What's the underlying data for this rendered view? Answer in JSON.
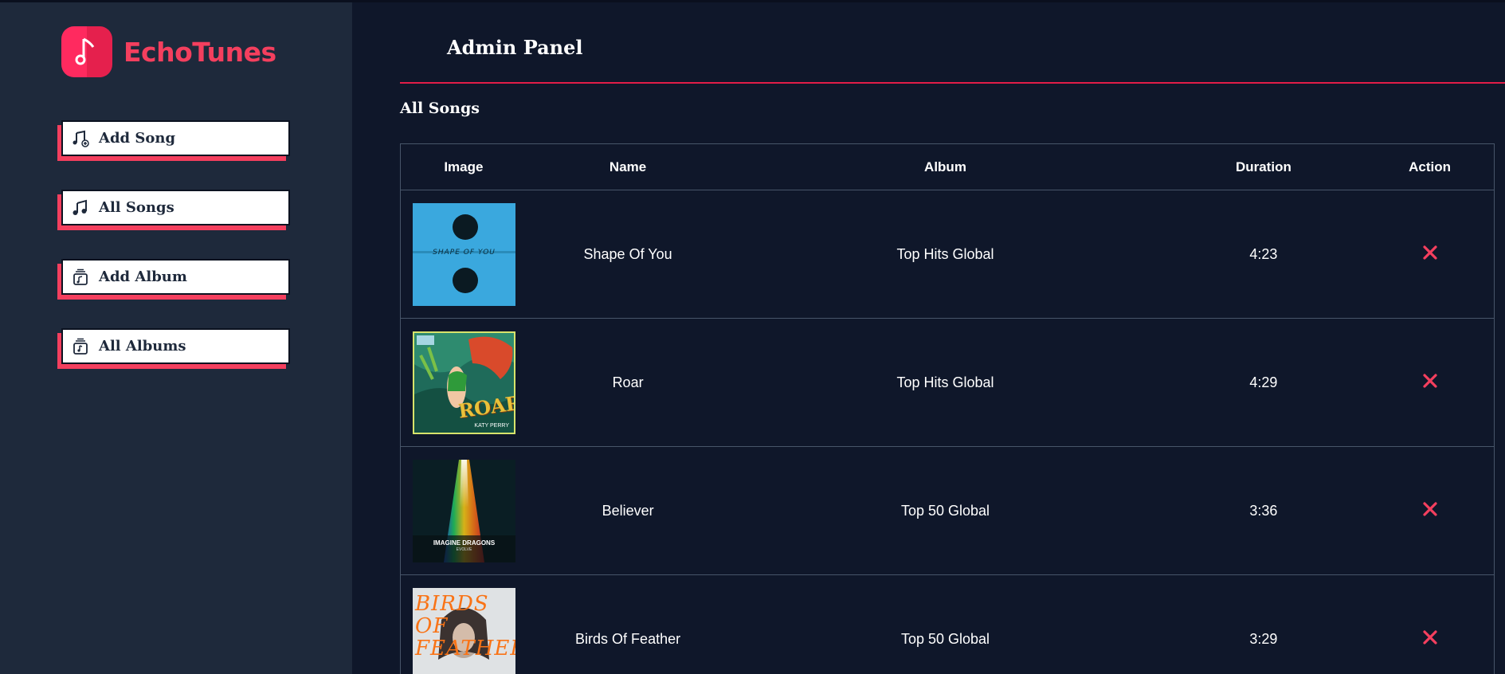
{
  "brand": {
    "name": "EchoTunes",
    "accent": "#f43f5e"
  },
  "sidebar": {
    "items": [
      {
        "label": "Add Song",
        "icon": "add-song-icon"
      },
      {
        "label": "All Songs",
        "icon": "music-note-icon"
      },
      {
        "label": "Add Album",
        "icon": "add-album-icon"
      },
      {
        "label": "All Albums",
        "icon": "album-list-icon"
      }
    ]
  },
  "header": {
    "title": "Admin Panel"
  },
  "main": {
    "section_title": "All Songs",
    "columns": [
      "Image",
      "Name",
      "Album",
      "Duration",
      "Action"
    ],
    "rows": [
      {
        "name": "Shape Of You",
        "album": "Top Hits Global",
        "duration": "4:23",
        "cover_text": "SHAPE OF YOU"
      },
      {
        "name": "Roar",
        "album": "Top Hits Global",
        "duration": "4:29",
        "cover_text": "ROAR",
        "cover_subtext": "KATY PERRY"
      },
      {
        "name": "Believer",
        "album": "Top 50 Global",
        "duration": "3:36",
        "cover_text": "IMAGINE DRAGONS",
        "cover_subtext": "EVOLVE"
      },
      {
        "name": "Birds Of Feather",
        "album": "Top 50 Global",
        "duration": "3:29",
        "cover_text": "BIRDS OF FEATHER"
      }
    ],
    "delete_icon": "close-icon"
  }
}
